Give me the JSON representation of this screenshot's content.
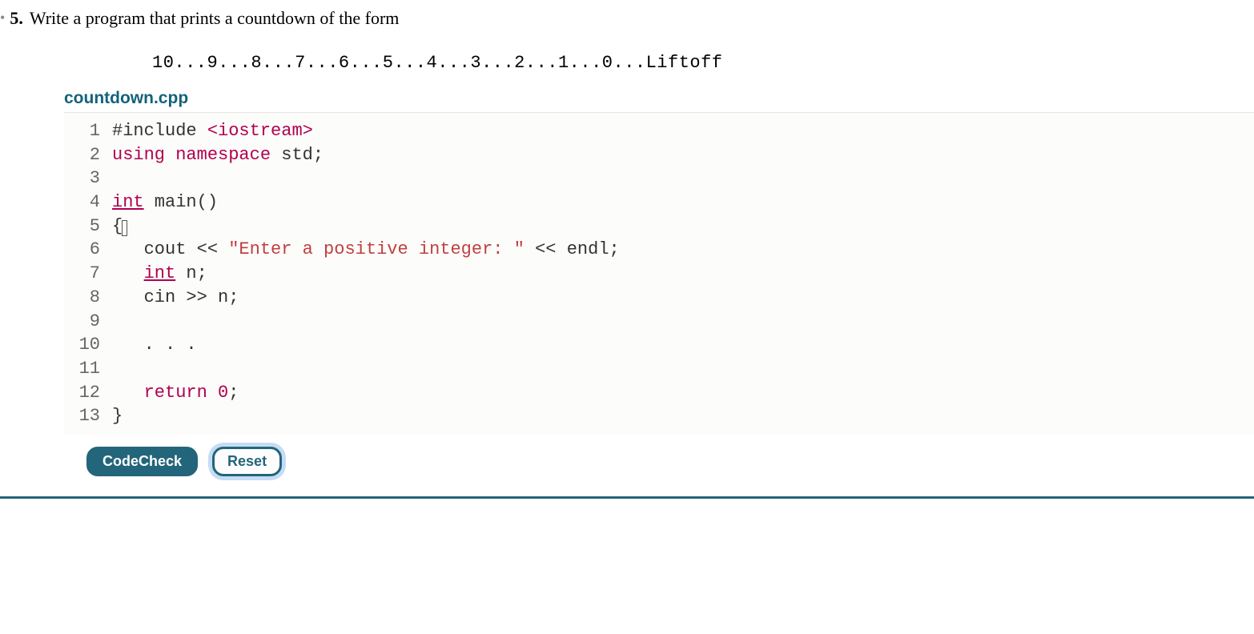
{
  "question": {
    "bullet": "•",
    "number": "5.",
    "text": "Write a program that prints a countdown of the form"
  },
  "sample_output": "10...9...8...7...6...5...4...3...2...1...0...Liftoff",
  "filename": "countdown.cpp",
  "code": {
    "line_numbers": [
      "1",
      "2",
      "3",
      "4",
      "5",
      "6",
      "7",
      "8",
      "9",
      "10",
      "11",
      "12",
      "13"
    ],
    "lines": [
      {
        "tokens": [
          {
            "t": "#include ",
            "c": "include"
          },
          {
            "t": "<iostream>",
            "c": "header"
          }
        ]
      },
      {
        "tokens": [
          {
            "t": "using",
            "c": "keyword"
          },
          {
            "t": " ",
            "c": "plain"
          },
          {
            "t": "namespace",
            "c": "keyword"
          },
          {
            "t": " std;",
            "c": "plain"
          }
        ]
      },
      {
        "tokens": []
      },
      {
        "tokens": [
          {
            "t": "int",
            "c": "type"
          },
          {
            "t": " main()",
            "c": "plain"
          }
        ]
      },
      {
        "tokens": [
          {
            "t": "{",
            "c": "plain"
          },
          {
            "t": "",
            "c": "cursor"
          }
        ]
      },
      {
        "tokens": [
          {
            "t": "   cout << ",
            "c": "plain"
          },
          {
            "t": "\"Enter a positive integer: \"",
            "c": "string"
          },
          {
            "t": " << endl;",
            "c": "plain"
          }
        ]
      },
      {
        "tokens": [
          {
            "t": "   ",
            "c": "plain"
          },
          {
            "t": "int",
            "c": "type"
          },
          {
            "t": " n;",
            "c": "plain"
          }
        ]
      },
      {
        "tokens": [
          {
            "t": "   cin >> n;",
            "c": "plain"
          }
        ]
      },
      {
        "tokens": []
      },
      {
        "tokens": [
          {
            "t": "   . . .",
            "c": "plain"
          }
        ]
      },
      {
        "tokens": []
      },
      {
        "tokens": [
          {
            "t": "   ",
            "c": "plain"
          },
          {
            "t": "return",
            "c": "keyword"
          },
          {
            "t": " ",
            "c": "plain"
          },
          {
            "t": "0",
            "c": "number"
          },
          {
            "t": ";",
            "c": "plain"
          }
        ]
      },
      {
        "tokens": [
          {
            "t": "}",
            "c": "plain"
          }
        ]
      }
    ]
  },
  "buttons": {
    "codecheck": "CodeCheck",
    "reset": "Reset"
  }
}
